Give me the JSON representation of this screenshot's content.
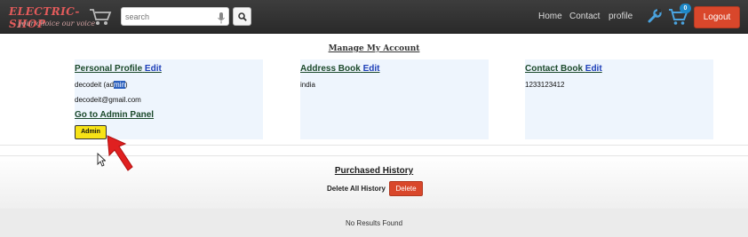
{
  "header": {
    "brand_name": "ELECTRIC-SHOP",
    "brand_tagline": "your choice our voice",
    "search": {
      "placeholder": "search",
      "value": ""
    },
    "nav": [
      {
        "label": "Home"
      },
      {
        "label": "Contact"
      },
      {
        "label": "profile"
      }
    ],
    "cart_count": "0",
    "logout_label": "Logout"
  },
  "account": {
    "title": "Manage My Account",
    "personal_profile": {
      "heading": "Personal Profile",
      "edit_label": "Edit",
      "name_prefix": "decodeit (ad",
      "name_highlight": "min",
      "name_suffix": ")",
      "email": "decodeit@gmail.com",
      "admin_panel_link": "Go to Admin Panel",
      "admin_button": "Admin"
    },
    "address_book": {
      "heading": "Address Book",
      "edit_label": "Edit",
      "address": "india"
    },
    "contact_book": {
      "heading": "Contact Book",
      "edit_label": "Edit",
      "phone": "1233123412"
    }
  },
  "history": {
    "title": "Purchased History",
    "delete_all_label": "Delete All History",
    "delete_button": "Delete",
    "empty_message": "No Results Found"
  },
  "colors": {
    "navbar": "#2f2f2f",
    "logout": "#d9472b",
    "panel_bg": "#eef5fd",
    "admin_button": "#f7e316",
    "edit_link": "#1d3fb8",
    "cart_badge": "#1e88c7"
  }
}
